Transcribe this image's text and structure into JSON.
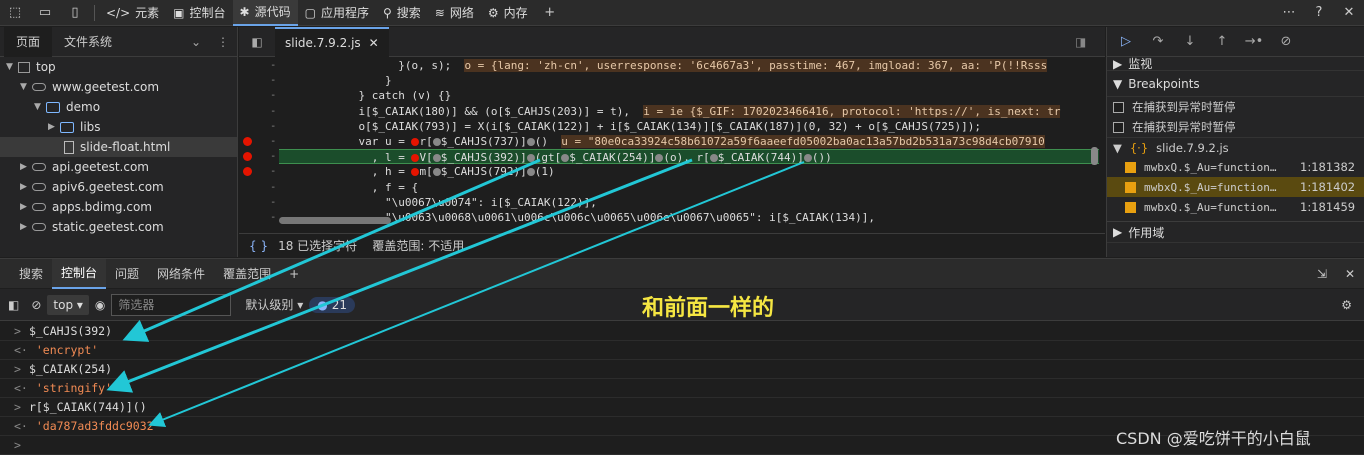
{
  "topbar": {
    "tabs": [
      "元素",
      "控制台",
      "源代码",
      "应用程序",
      "搜索",
      "网络",
      "内存"
    ]
  },
  "left": {
    "tabs": [
      "页面",
      "文件系统"
    ],
    "tree": [
      "top",
      "www.geetest.com",
      "demo",
      "libs",
      "slide-float.html",
      "api.geetest.com",
      "apiv6.geetest.com",
      "apps.bdimg.com",
      "static.geetest.com"
    ]
  },
  "editor": {
    "filename": "slide.7.9.2.js",
    "lines": [
      {
        "pre": "                  }(o, s);  ",
        "inl": "o = {lang: 'zh-cn', userresponse: '6c4667a3', passtime: 467, imgload: 367, aa: 'P(!!Rsss"
      },
      {
        "pre": "                }",
        "inl": ""
      },
      {
        "pre": "            } catch (v) {}",
        "inl": ""
      },
      {
        "pre": "            i[$_CAIAK(180)] && (o[$_CAHJS(203)] = t),  ",
        "inl": "i = ie {$_GIF: 1702023466416, protocol: 'https://', is_next: tr"
      },
      {
        "pre": "            o[$_CAIAK(793)] = X(i[$_CAIAK(122)] + i[$_CAIAK(134)][$_CAIAK(187)](0, 32) + o[$_CAHJS(725)]);",
        "inl": ""
      },
      {
        "pre": "            var u = ●r[●$_CAHJS(737)]●()  ",
        "inl": "u = \"80e0ca33924c58b61072a59f6aaeefd05002ba0ac13a57bd2b531a73c98d4cb07910"
      },
      {
        "pre": "              , l = ●V[●$_CAHJS(392)]●(gt[●$_CAIAK(254)]●(o), r[●$_CAIAK(744)]●())",
        "inl": ""
      },
      {
        "pre": "              , h = ●m[●$_CAHJS(792)]●(1)",
        "inl": ""
      },
      {
        "pre": "              , f = {",
        "inl": ""
      },
      {
        "pre": "                \"\\u0067\\u0074\": i[$_CAIAK(122)],",
        "inl": ""
      },
      {
        "pre": "                \"\\u0063\\u0068\\u0061\\u006c\\u006c\\u0065\\u006e\\u0067\\u0065\": i[$_CAIAK(134)],",
        "inl": ""
      }
    ],
    "gutter": [
      "-",
      "-",
      "-",
      "-",
      "-",
      "-",
      "-",
      "-",
      "-",
      "-",
      "-"
    ],
    "status": "18 已选择字符    覆盖范围: 不适用"
  },
  "right": {
    "watch": "监视",
    "breakpoints": "Breakpoints",
    "pause_uncaught": "在捕获到异常时暂停",
    "pause_caught": "在捕获到异常时暂停",
    "file": "slide.7.9.2.js",
    "bps": [
      {
        "name": "mwbxQ.$_Au=function…",
        "line": "1:181382"
      },
      {
        "name": "mwbxQ.$_Au=function…",
        "line": "1:181402"
      },
      {
        "name": "mwbxQ.$_Au=function…",
        "line": "1:181459"
      }
    ],
    "scope": "作用域"
  },
  "drawer": {
    "tabs": [
      "搜索",
      "控制台",
      "问题",
      "网络条件",
      "覆盖范围"
    ]
  },
  "console_toolbar": {
    "context": "top",
    "filter_placeholder": "筛选器",
    "level": "默认级别",
    "count": "21"
  },
  "console": [
    {
      "prompt": ">",
      "text": "$_CAHJS(392)",
      "type": "in"
    },
    {
      "prompt": "<·",
      "text": "'encrypt'",
      "type": "out"
    },
    {
      "prompt": ">",
      "text": "$_CAIAK(254)",
      "type": "in"
    },
    {
      "prompt": "<·",
      "text": "'stringify'",
      "type": "out"
    },
    {
      "prompt": ">",
      "text": " r[$_CAIAK(744)]()",
      "type": "in"
    },
    {
      "prompt": "<·",
      "text": "'da787ad3fddc9032'",
      "type": "out"
    },
    {
      "prompt": ">",
      "text": "",
      "type": "in"
    }
  ],
  "annotation": "和前面一样的",
  "watermark": "CSDN @爱吃饼干的小白鼠",
  "colors": {
    "arrow": "#22c7d6",
    "note": "#f5e642",
    "highlight": "#1b4d2b"
  }
}
